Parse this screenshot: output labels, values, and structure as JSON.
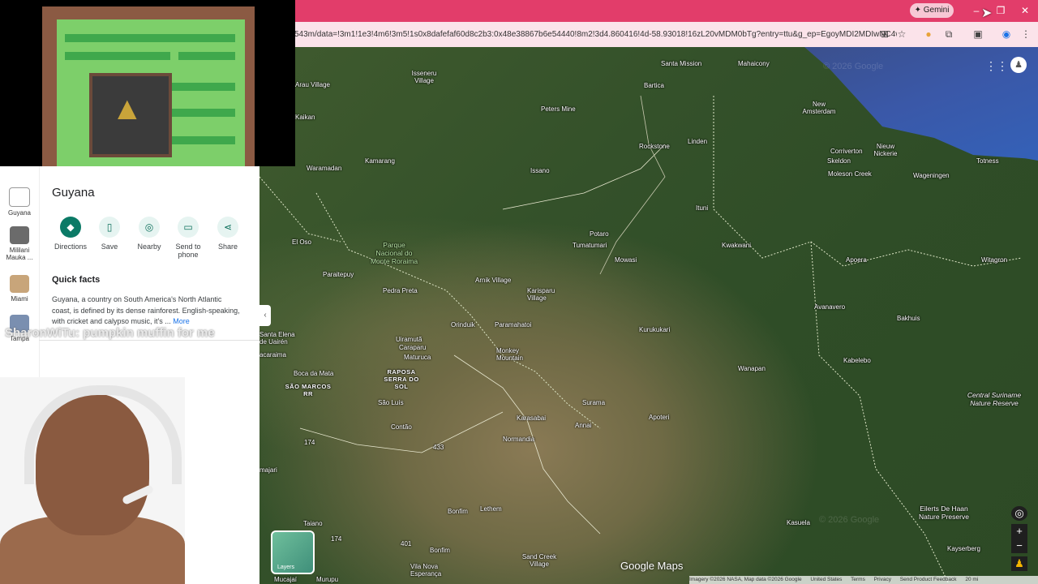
{
  "browser": {
    "gemini_label": "Gemini",
    "url": "543m/data=!3m1!1e3!4m6!3m5!1s0x8dafefaf60d8c2b3:0x48e38867b6e54440!8m2!3d4.860416!4d-58.93018!16zL20vMDM0bTg?entry=ttu&g_ep=EgoyMDI2MDIwNC4wIKXX..."
  },
  "panel": {
    "rail": [
      {
        "label": "Guyana"
      },
      {
        "label": "Mililani Mauka ..."
      },
      {
        "label": "Miami"
      },
      {
        "label": "Tampa"
      }
    ],
    "title": "Guyana",
    "actions": [
      {
        "label": "Directions",
        "icon": "directions-icon"
      },
      {
        "label": "Save",
        "icon": "bookmark-icon"
      },
      {
        "label": "Nearby",
        "icon": "nearby-icon"
      },
      {
        "label": "Send to phone",
        "icon": "phone-icon"
      },
      {
        "label": "Share",
        "icon": "share-icon"
      }
    ],
    "quick_facts_title": "Quick facts",
    "quick_facts_text": "Guyana, a country on South America's North Atlantic coast, is defined by its dense rainforest. English-speaking, with cricket and calypso music, it's ...",
    "quick_facts_more": "More"
  },
  "stream": {
    "chat_message": "SharonWiTu: pumpkin muffin for me"
  },
  "map": {
    "labels": {
      "isseneru": "Isseneru Village",
      "santa_mission": "Santa Mission",
      "mahaicony": "Mahaicony",
      "arau": "Arau Village",
      "bartica": "Bartica",
      "peters_mine": "Peters Mine",
      "kaikan": "Kaikan",
      "new_amsterdam": "New Amsterdam",
      "rockstone": "Rockstone",
      "linden": "Linden",
      "corriverton": "Corriverton",
      "nieuw_nickerie": "Nieuw Nickerie",
      "totness": "Totness",
      "kamarang": "Kamarang",
      "skeldon": "Skeldon",
      "waramadan": "Waramadan",
      "issano": "Issano",
      "moleson_creek": "Moleson Creek",
      "wageningen": "Wageningen",
      "ituni": "Ituni",
      "el_oso": "El Oso",
      "parque": "Parque Nacional do Monte Roraima",
      "potaro": "Potaro",
      "tumatumari": "Tumatumari",
      "kwakwani": "Kwakwani",
      "apoera": "Apoera",
      "witagron": "Witagron",
      "paraitepuy": "Paraitepuy",
      "mowasi": "Mowasi",
      "arnik": "Arnik Village",
      "pedra_preta": "Pedra Preta",
      "karisparu": "Karisparu Village",
      "avanavero": "Avanavero",
      "paramahatoi": "Paramahatoi",
      "bakhuis": "Bakhuis",
      "orinduik": "Orinduik",
      "kurukukari": "Kurukukari",
      "santa_elena": "Santa Elena de Uairén",
      "uiramuta": "Uiramutã",
      "caraparu": "Caraparu",
      "monkey_mountain": "Monkey Mountain",
      "kabelebo": "Kabelebo",
      "acaraima": "acaraima",
      "maturuca": "Maturuca",
      "raposa": "RAPOSA SERRA DO SOL",
      "wanapan": "Wanapan",
      "boca_da_mata": "Boca da Mata",
      "sao_marcos": "SÃO MARCOS RR",
      "sao_luis": "São Luís",
      "surama": "Surama",
      "central_suriname": "Central Suriname Nature Reserve",
      "karasabai": "Karasabai",
      "apoteri": "Apoteri",
      "annai": "Annai",
      "contao": "Contão",
      "normandia": "Normandia",
      "eilerts": "Eilerts De Haan Nature Preserve",
      "rt174a": "174",
      "rt433": "433",
      "majari": "majari",
      "kasuela": "Kasuela",
      "bonfim": "Bonfim",
      "lethem": "Lethem",
      "taiano": "Taiano",
      "rt174b": "174",
      "rt401": "401",
      "kayserberg": "Kayserberg",
      "bonfim2": "Bonfim",
      "sand_creek": "Sand Creek Village",
      "vila_nova": "Vila Nova Esperança",
      "mucajai": "Mucajaí",
      "murupu": "Murupu"
    },
    "watermark_1": "© 2026 Google",
    "watermark_2": "© 2026 Google",
    "brand": "Google Maps",
    "layers_label": "Layers",
    "footer": [
      "Imagery ©2026 NASA, Map data ©2026 Google",
      "United States",
      "Terms",
      "Privacy",
      "Send Product Feedback",
      "20 mi"
    ]
  }
}
